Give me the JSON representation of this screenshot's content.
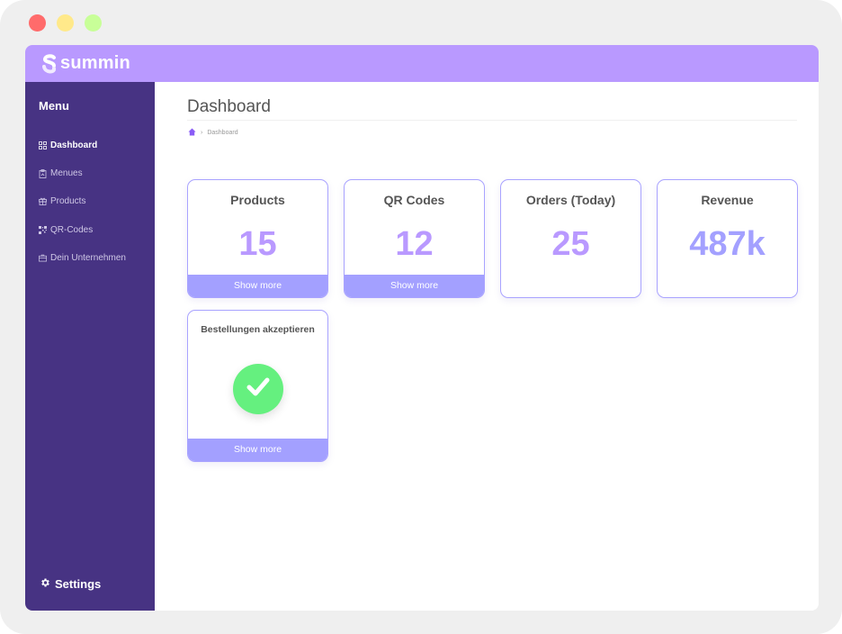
{
  "window_controls": [
    "close",
    "minimize",
    "maximize"
  ],
  "brand": {
    "name": "summin",
    "icon": "summin-logo-icon",
    "color": "#b999ff"
  },
  "sidebar": {
    "title": "Menu",
    "items": [
      {
        "label": "Dashboard",
        "icon": "grid-icon",
        "active": true
      },
      {
        "label": "Menues",
        "icon": "clipboard-icon",
        "active": false
      },
      {
        "label": "Products",
        "icon": "gift-icon",
        "active": false
      },
      {
        "label": "QR-Codes",
        "icon": "qr-code-icon",
        "active": false
      },
      {
        "label": "Dein Unternehmen",
        "icon": "briefcase-icon",
        "active": false
      }
    ],
    "settings_label": "Settings",
    "settings_icon": "gear-icon",
    "color": "#473383"
  },
  "page": {
    "title": "Dashboard",
    "breadcrumb": {
      "home_icon": "home-icon",
      "separator": "›",
      "current": "Dashboard"
    }
  },
  "cards": [
    {
      "title": "Products",
      "value": "15",
      "action": "Show more"
    },
    {
      "title": "QR Codes",
      "value": "12",
      "action": "Show more"
    },
    {
      "title": "Orders (Today)",
      "value": "25"
    },
    {
      "title": "Revenue",
      "value": "487k"
    },
    {
      "title": "Bestellungen akzeptieren",
      "status_icon": "check-icon",
      "status": "accepting",
      "action": "Show more"
    }
  ],
  "colors": {
    "accent": "#a3a0ff",
    "value_purple": "#b999ff",
    "success": "#65f07f"
  }
}
